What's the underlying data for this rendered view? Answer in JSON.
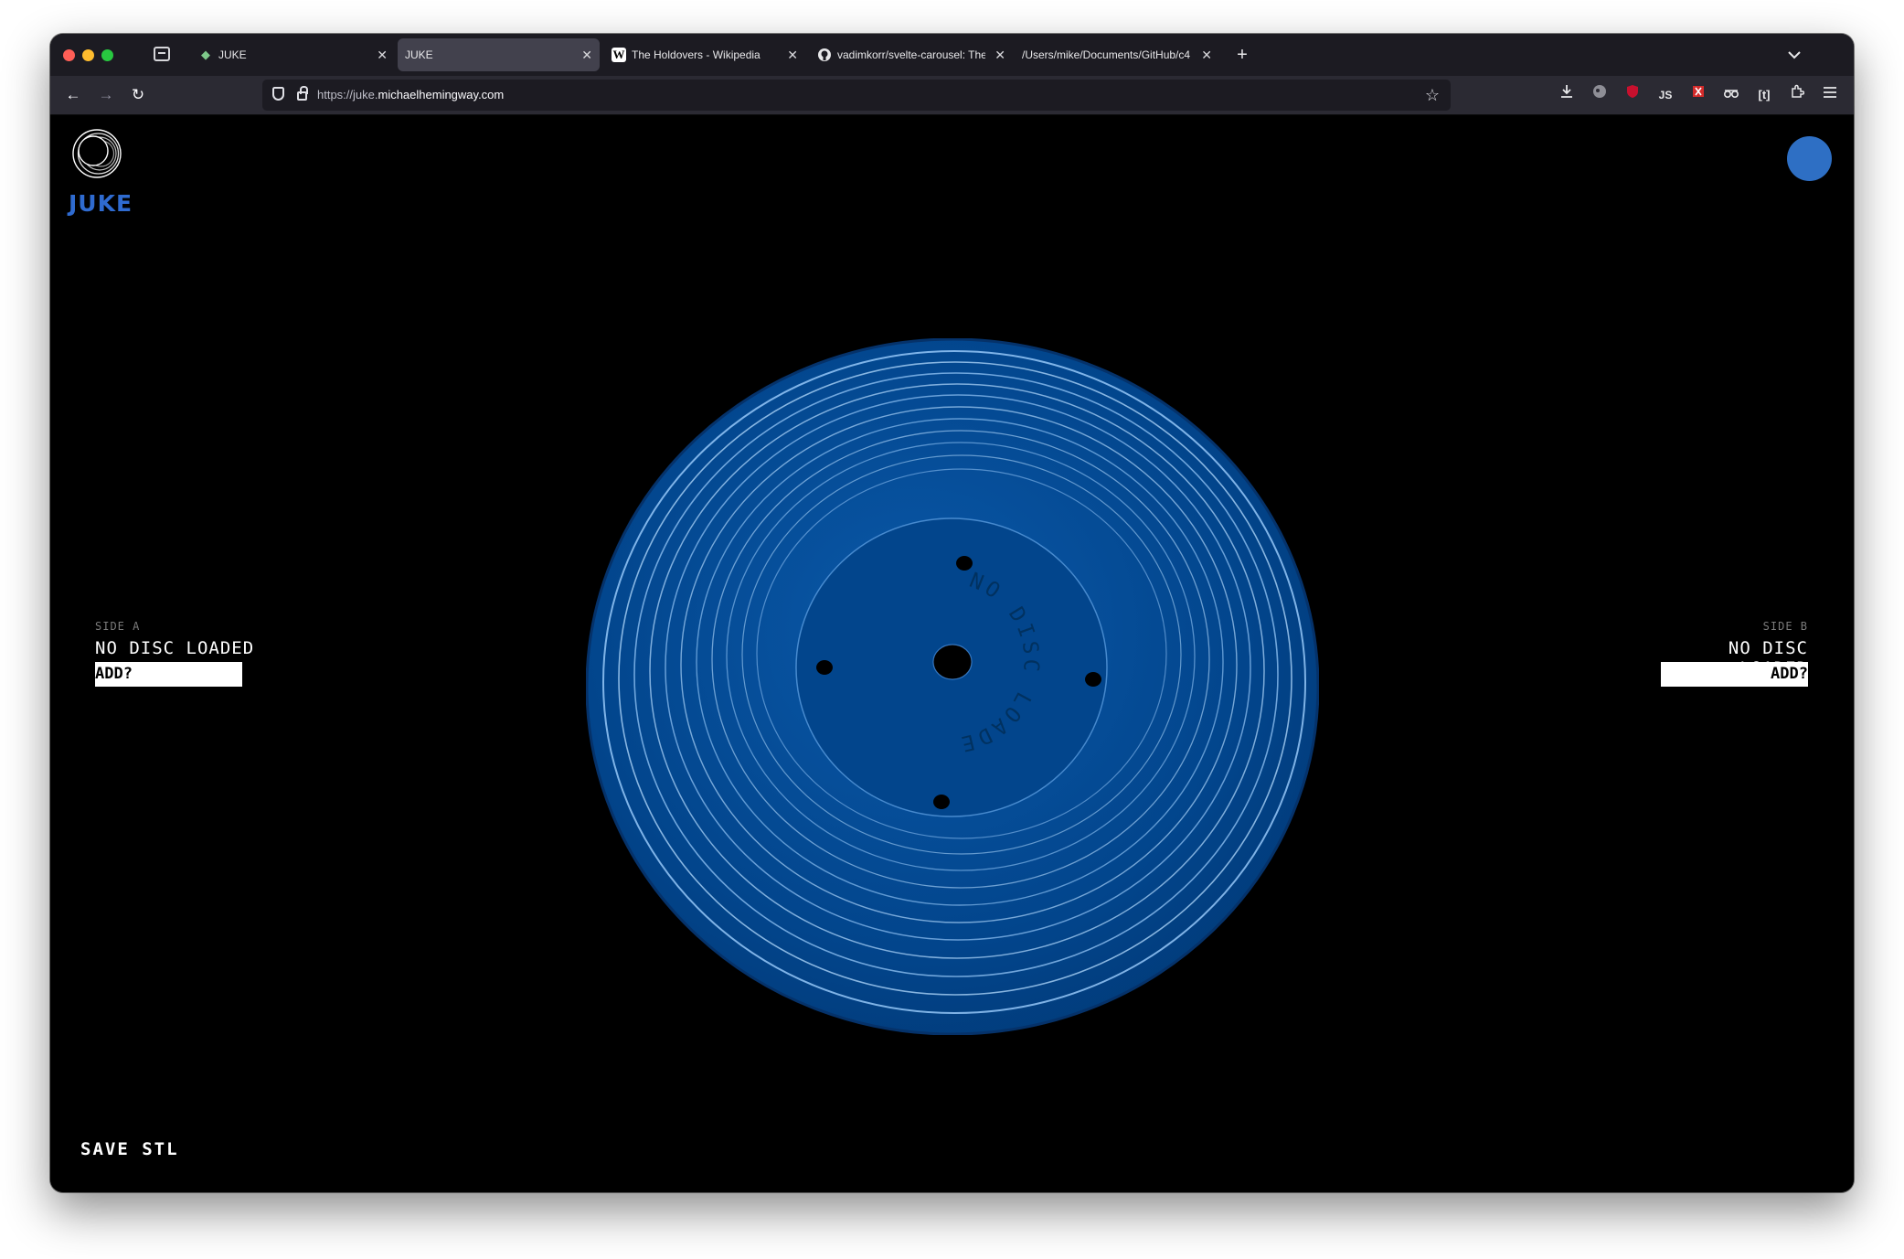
{
  "browser": {
    "tabs": [
      {
        "label": "JUKE",
        "favicon": "green-leaf-icon",
        "active": false
      },
      {
        "label": "JUKE",
        "favicon": "",
        "active": true
      },
      {
        "label": "The Holdovers - Wikipedia",
        "favicon": "W",
        "active": false
      },
      {
        "label": "vadimkorr/svelte-carousel: The",
        "favicon": "github-icon",
        "active": false
      },
      {
        "label": "/Users/mike/Documents/GitHub/c4",
        "favicon": "",
        "active": false
      }
    ],
    "new_tab_label": "+",
    "url_prefix": "https://juke.",
    "url_domain": "michaelhemingway.com"
  },
  "app": {
    "brand": "JUKE",
    "accent_color": "#2f6bd0",
    "disc_color": "#02458c",
    "disc_label": "NO DISC LOADED",
    "side_a": {
      "tag": "SIDE A",
      "status": "NO DISC LOADED",
      "add_label": "ADD?"
    },
    "side_b": {
      "tag": "SIDE B",
      "status": "NO DISC LOADED",
      "add_label": "ADD?"
    },
    "save_label": "SAVE STL"
  }
}
